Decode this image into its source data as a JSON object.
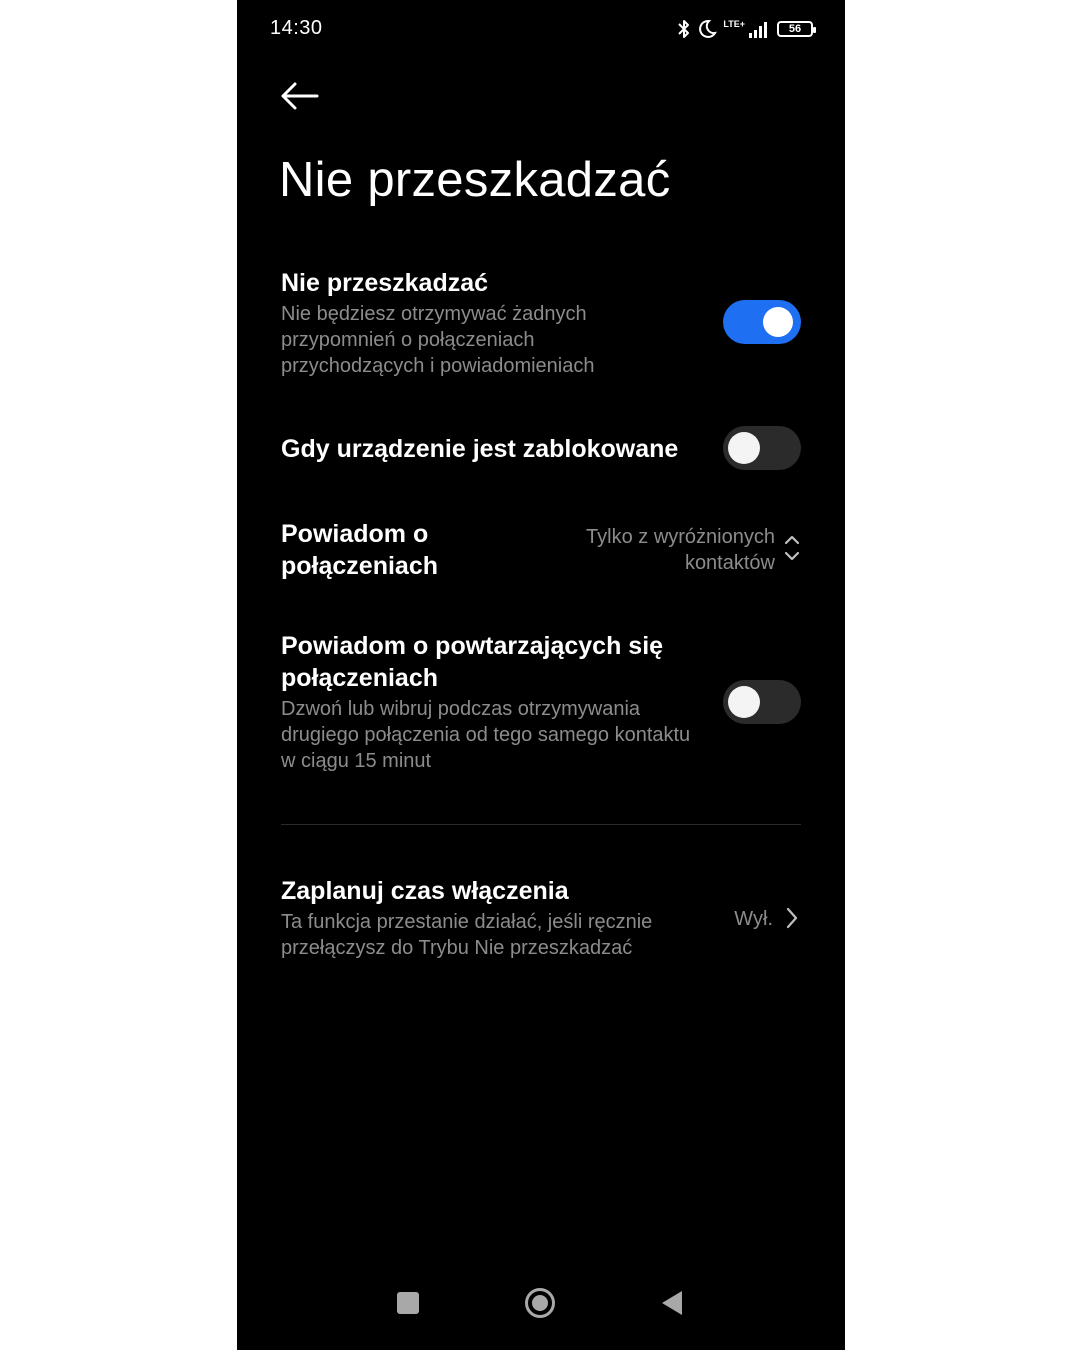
{
  "status_bar": {
    "time": "14:30",
    "network": "LTE+",
    "battery": "56",
    "icons": [
      "bluetooth-icon",
      "moon-icon",
      "signal-icon",
      "battery-icon"
    ]
  },
  "header": {
    "back_icon": "arrow-left-icon",
    "title": "Nie przeszkadzać"
  },
  "settings": {
    "dnd": {
      "title": "Nie przeszkadzać",
      "desc": "Nie będziesz otrzymywać żadnych przypomnień o połączeniach przychodzących i powiadomieniach",
      "enabled": true
    },
    "locked": {
      "title": "Gdy urządzenie jest zablokowane",
      "enabled": false
    },
    "calls": {
      "title": "Powiadom o połączeniach",
      "value": "Tylko z wyróżnionych kontaktów"
    },
    "repeat": {
      "title": "Powiadom o powtarzających się połączeniach",
      "desc": "Dzwoń lub wibruj podczas otrzymywania drugiego połączenia od tego samego kontaktu w ciągu 15 minut",
      "enabled": false
    },
    "schedule": {
      "title": "Zaplanuj czas włączenia",
      "desc": "Ta funkcja przestanie działać, jeśli ręcznie przełączysz do Trybu Nie przeszkadzać",
      "value": "Wył."
    }
  },
  "colors": {
    "accent": "#1e6ff2",
    "background": "#000000",
    "secondary_text": "#8c8c8c"
  }
}
